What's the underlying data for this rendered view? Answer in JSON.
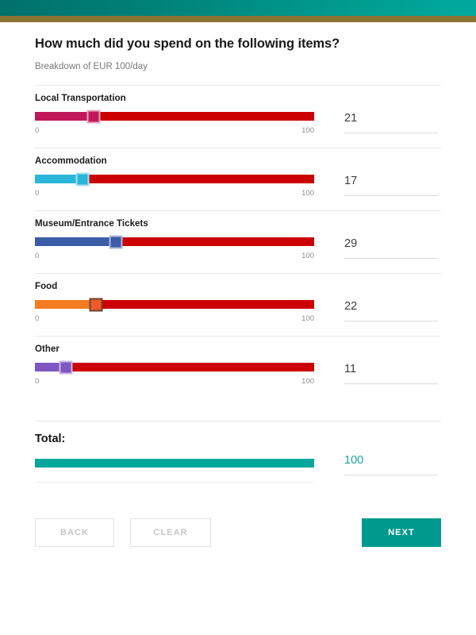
{
  "app": {
    "statusbar_color": "#00837a",
    "accent_bar_color": "#8a7535"
  },
  "header": {
    "title": "How much did you spend on the following items?",
    "subtitle": "Breakdown of EUR 100/day"
  },
  "scale": {
    "min_label": "0",
    "max_label": "100",
    "min": 0,
    "max": 100
  },
  "track": {
    "remaining_color": "#cc0000"
  },
  "items": [
    {
      "label": "Local Transportation",
      "value": 21,
      "value_text": "21",
      "fill_color": "#c2185b",
      "thumb_color": "#c2185b",
      "thumb_border": "#e8aac3"
    },
    {
      "label": "Accommodation",
      "value": 17,
      "value_text": "17",
      "fill_color": "#29b6d8",
      "thumb_color": "#29b6d8",
      "thumb_border": "#a8e1ee"
    },
    {
      "label": "Museum/Entrance Tickets",
      "value": 29,
      "value_text": "29",
      "fill_color": "#3b5ca8",
      "thumb_color": "#3b5ca8",
      "thumb_border": "#aebad8"
    },
    {
      "label": "Food",
      "value": 22,
      "value_text": "22",
      "fill_color": "#f57c20",
      "thumb_color": "#f05a28",
      "thumb_border": "#6b4430"
    },
    {
      "label": "Other",
      "value": 11,
      "value_text": "11",
      "fill_color": "#7e57c2",
      "thumb_color": "#7e57c2",
      "thumb_border": "#c9b6e6"
    }
  ],
  "total": {
    "label": "Total:",
    "value": 100,
    "value_text": "100",
    "bar_color": "#00a79a",
    "text_color": "#18a79c"
  },
  "footer": {
    "back_label": "BACK",
    "clear_label": "CLEAR",
    "next_label": "NEXT",
    "next_color": "#00998e"
  }
}
